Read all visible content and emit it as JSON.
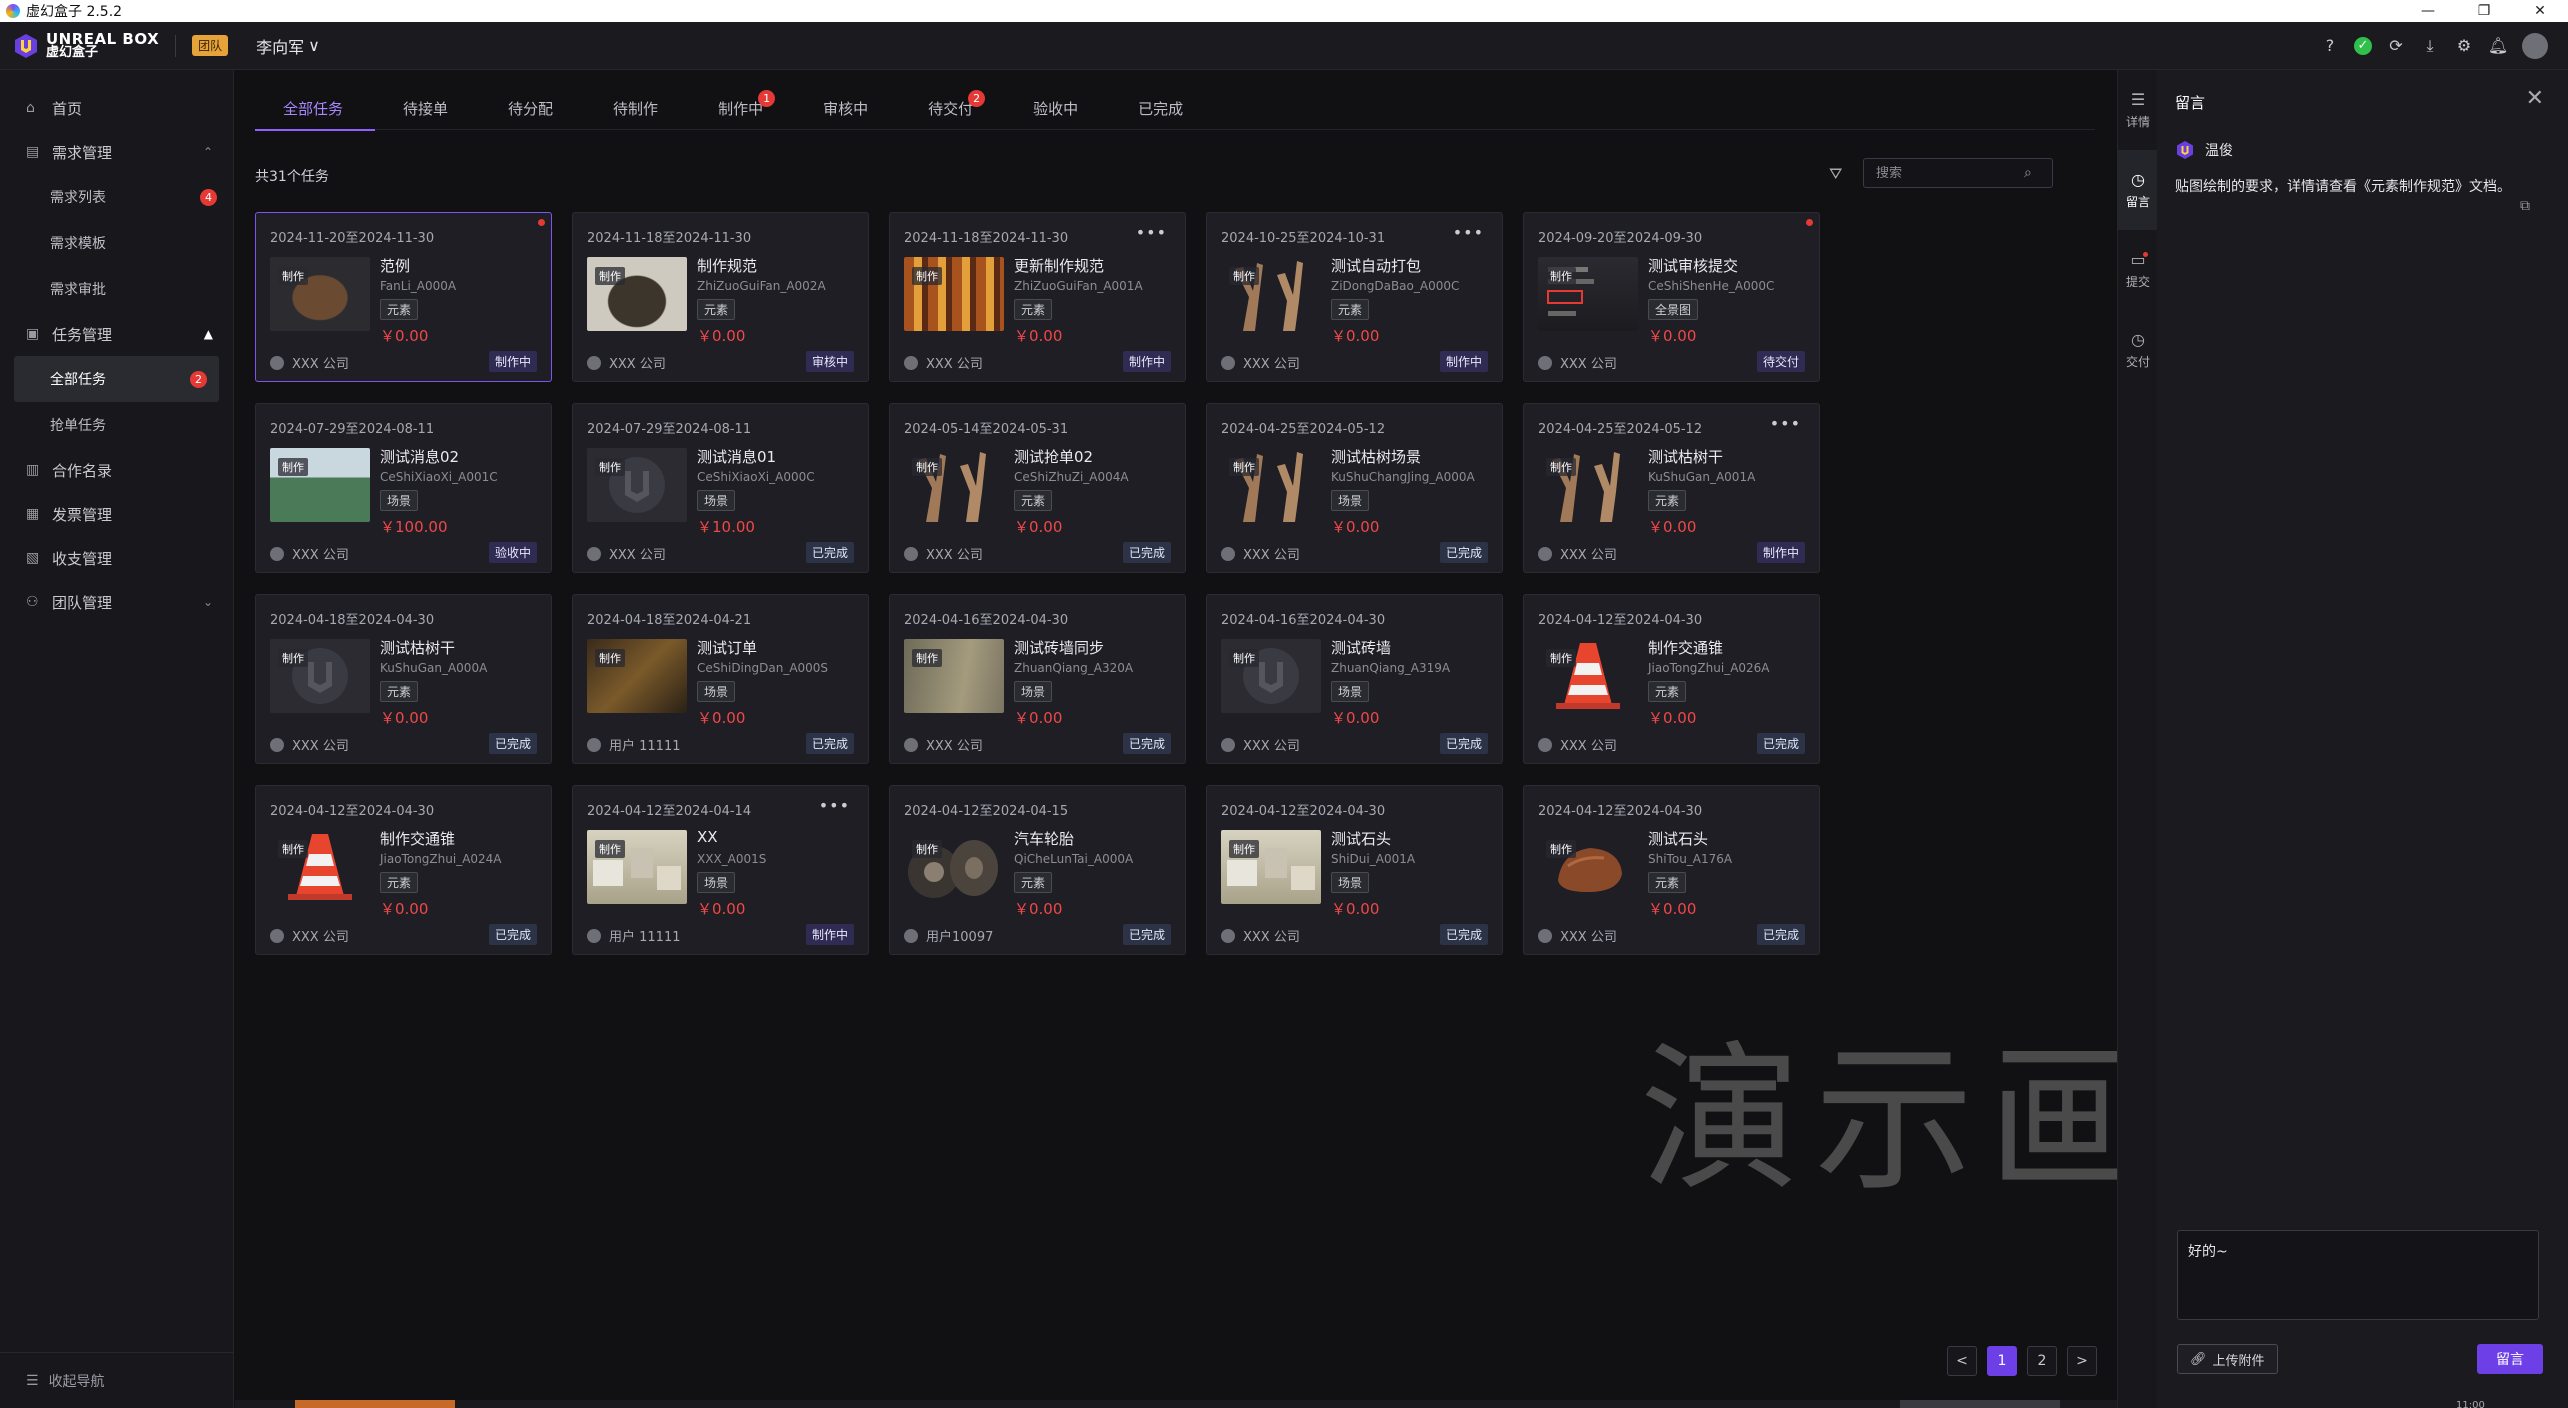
{
  "window": {
    "title": "虚幻盒子 2.5.2",
    "controls": [
      "—",
      "❐",
      "✕"
    ]
  },
  "header": {
    "logo_en": "UNREAL BOX",
    "logo_cn": "虚幻盒子",
    "team_badge": "团队",
    "user": "李向军",
    "user_chevron": "∨",
    "tool_icons": [
      "help-icon",
      "status-ok-icon",
      "refresh-icon",
      "download-icon",
      "settings-icon",
      "bell-icon",
      "avatar"
    ]
  },
  "sidebar": {
    "items": [
      {
        "label": "首页",
        "icon": "home-icon"
      },
      {
        "label": "需求管理",
        "icon": "doc-icon",
        "expanded": true,
        "children": [
          {
            "label": "需求列表",
            "badge": "4"
          },
          {
            "label": "需求模板"
          },
          {
            "label": "需求审批"
          }
        ]
      },
      {
        "label": "任务管理",
        "icon": "clipboard-icon",
        "expanded": true,
        "children": [
          {
            "label": "全部任务",
            "badge": "2",
            "active": true
          },
          {
            "label": "抢单任务"
          }
        ]
      },
      {
        "label": "合作名录",
        "icon": "book-icon"
      },
      {
        "label": "发票管理",
        "icon": "invoice-icon"
      },
      {
        "label": "收支管理",
        "icon": "wallet-icon"
      },
      {
        "label": "团队管理",
        "icon": "team-icon",
        "collapsed": true
      }
    ],
    "footer": "收起导航"
  },
  "tabs": [
    {
      "label": "全部任务",
      "active": true
    },
    {
      "label": "待接单"
    },
    {
      "label": "待分配"
    },
    {
      "label": "待制作"
    },
    {
      "label": "制作中",
      "badge": "1"
    },
    {
      "label": "审核中"
    },
    {
      "label": "待交付",
      "badge": "2"
    },
    {
      "label": "验收中"
    },
    {
      "label": "已完成"
    }
  ],
  "total_label": "共31个任务",
  "search": {
    "placeholder": "搜索"
  },
  "make_tag": "制作",
  "cards": [
    {
      "date": "2024-11-20至2024-11-30",
      "title": "范例",
      "code": "FanLi_A000A",
      "type": "元素",
      "price": "￥0.00",
      "owner": "XXX 公司",
      "status": "制作中",
      "thumb": "t-jar",
      "dot": true,
      "selected": true
    },
    {
      "date": "2024-11-18至2024-11-30",
      "title": "制作规范",
      "code": "ZhiZuoGuiFan_A002A",
      "type": "元素",
      "price": "￥0.00",
      "owner": "XXX 公司",
      "status": "审核中",
      "thumb": "t-jar2"
    },
    {
      "date": "2024-11-18至2024-11-30",
      "title": "更新制作规范",
      "code": "ZhiZuoGuiFan_A001A",
      "type": "元素",
      "price": "￥0.00",
      "owner": "XXX 公司",
      "status": "制作中",
      "thumb": "t-shelf",
      "more": true
    },
    {
      "date": "2024-10-25至2024-10-31",
      "title": "测试自动打包",
      "code": "ZiDongDaBao_A000C",
      "type": "元素",
      "price": "￥0.00",
      "owner": "XXX 公司",
      "status": "制作中",
      "thumb": "t-branch",
      "more": true
    },
    {
      "date": "2024-09-20至2024-09-30",
      "title": "测试审核提交",
      "code": "CeShiShenHe_A000C",
      "type": "全景图",
      "price": "￥0.00",
      "owner": "XXX 公司",
      "status": "待交付",
      "thumb": "t-ui",
      "dot": true
    },
    {
      "date": "2024-07-29至2024-08-11",
      "title": "测试消息02",
      "code": "CeShiXiaoXi_A001C",
      "type": "场景",
      "price": "￥100.00",
      "owner": "XXX 公司",
      "status": "验收中",
      "thumb": "t-house"
    },
    {
      "date": "2024-07-29至2024-08-11",
      "title": "测试消息01",
      "code": "CeShiXiaoXi_A000C",
      "type": "场景",
      "price": "￥10.00",
      "owner": "XXX 公司",
      "status": "已完成",
      "thumb": "t-logo"
    },
    {
      "date": "2024-05-14至2024-05-31",
      "title": "测试抢单02",
      "code": "CeShiZhuZi_A004A",
      "type": "元素",
      "price": "￥0.00",
      "owner": "XXX 公司",
      "status": "已完成",
      "thumb": "t-branch"
    },
    {
      "date": "2024-04-25至2024-05-12",
      "title": "测试枯树场景",
      "code": "KuShuChangJing_A000A",
      "type": "场景",
      "price": "￥0.00",
      "owner": "XXX 公司",
      "status": "已完成",
      "thumb": "t-branch"
    },
    {
      "date": "2024-04-25至2024-05-12",
      "title": "测试枯树干",
      "code": "KuShuGan_A001A",
      "type": "元素",
      "price": "￥0.00",
      "owner": "XXX 公司",
      "status": "制作中",
      "thumb": "t-branch",
      "more": true
    },
    {
      "date": "2024-04-18至2024-04-30",
      "title": "测试枯树干",
      "code": "KuShuGan_A000A",
      "type": "元素",
      "price": "￥0.00",
      "owner": "XXX 公司",
      "status": "已完成",
      "thumb": "t-logo"
    },
    {
      "date": "2024-04-18至2024-04-21",
      "title": "测试订单",
      "code": "CeShiDingDan_A000S",
      "type": "场景",
      "price": "￥0.00",
      "owner": "用户 11111",
      "status": "已完成",
      "thumb": "t-crowd"
    },
    {
      "date": "2024-04-16至2024-04-30",
      "title": "测试砖墙同步",
      "code": "ZhuanQiang_A320A",
      "type": "场景",
      "price": "￥0.00",
      "owner": "XXX 公司",
      "status": "已完成",
      "thumb": "t-wall"
    },
    {
      "date": "2024-04-16至2024-04-30",
      "title": "测试砖墙",
      "code": "ZhuanQiang_A319A",
      "type": "场景",
      "price": "￥0.00",
      "owner": "XXX 公司",
      "status": "已完成",
      "thumb": "t-logo"
    },
    {
      "date": "2024-04-12至2024-04-30",
      "title": "制作交通锥",
      "code": "JiaoTongZhui_A026A",
      "type": "元素",
      "price": "￥0.00",
      "owner": "XXX 公司",
      "status": "已完成",
      "thumb": "t-cone"
    },
    {
      "date": "2024-04-12至2024-04-30",
      "title": "制作交通锥",
      "code": "JiaoTongZhui_A024A",
      "type": "元素",
      "price": "￥0.00",
      "owner": "XXX 公司",
      "status": "已完成",
      "thumb": "t-cone"
    },
    {
      "date": "2024-04-12至2024-04-14",
      "title": "XX",
      "code": "XXX_A001S",
      "type": "场景",
      "price": "￥0.00",
      "owner": "用户 11111",
      "status": "制作中",
      "thumb": "t-street",
      "more": true
    },
    {
      "date": "2024-04-12至2024-04-15",
      "title": "汽车轮胎",
      "code": "QiCheLunTai_A000A",
      "type": "元素",
      "price": "￥0.00",
      "owner": "用户10097",
      "status": "已完成",
      "thumb": "t-tire"
    },
    {
      "date": "2024-04-12至2024-04-30",
      "title": "测试石头",
      "code": "ShiDui_A001A",
      "type": "场景",
      "price": "￥0.00",
      "owner": "XXX 公司",
      "status": "已完成",
      "thumb": "t-street"
    },
    {
      "date": "2024-04-12至2024-04-30",
      "title": "测试石头",
      "code": "ShiTou_A176A",
      "type": "元素",
      "price": "￥0.00",
      "owner": "XXX 公司",
      "status": "已完成",
      "thumb": "t-rock"
    }
  ],
  "pagination": {
    "prev": "<",
    "pages": [
      "1",
      "2"
    ],
    "current": "1",
    "next": ">"
  },
  "watermark": "演示画面",
  "rail": [
    {
      "label": "详情",
      "icon": "list-icon"
    },
    {
      "label": "留言",
      "icon": "clock-icon",
      "active": true
    },
    {
      "label": "提交",
      "icon": "folder-icon",
      "dot": true
    },
    {
      "label": "交付",
      "icon": "clock-icon"
    }
  ],
  "comment": {
    "title": "留言",
    "close": "✕",
    "user": "温俊",
    "message": "贴图绘制的要求，详情请查看《元素制作规范》文档。",
    "input_value": "好的~",
    "upload_label": "上传附件",
    "send_label": "留言"
  },
  "clock_text": "11:00"
}
